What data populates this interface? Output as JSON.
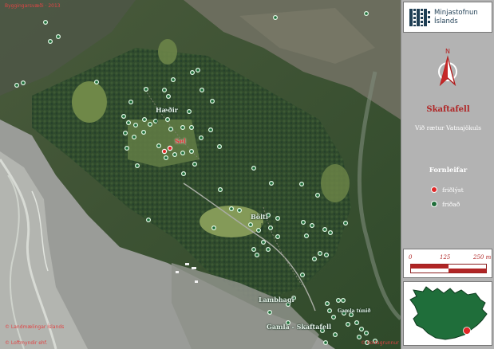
{
  "colors": {
    "site_red": "#e02828",
    "site_green": "#1f6e3a",
    "brand": "#1f3e54",
    "title_red": "#b02525"
  },
  "map": {
    "corner_top_left": "Byggingarsvæði · 2013",
    "corner_bottom_left": "© Landmælingar Íslands",
    "corner_bottom_left_2": "© Loftmyndir ehf.",
    "corner_bottom_right": "© Kortagrunnur",
    "place_labels": [
      "Hæðir",
      "Sel",
      "Bölti",
      "Lambhagi",
      "Gamla - Skaftafell",
      "Gamla túnið"
    ],
    "sites_protected_count": 2,
    "sites_unprotected_icon": "green-ring-dot",
    "sites_protected_icon": "red-ring-dot"
  },
  "sidebar": {
    "logo": {
      "line1": "Minjastofnun",
      "line2": "Íslands",
      "mark_icon": "minjastofnun-m-logo-icon"
    },
    "north_arrow": {
      "label": "N",
      "icon": "north-arrow-icon"
    },
    "place_title": "Skaftafell",
    "place_subtitle": "Við rætur Vatnajökuls",
    "legend": {
      "title": "Fornleifar",
      "items": [
        {
          "label": "friðlýst",
          "color": "#e02828"
        },
        {
          "label": "friðað",
          "color": "#1f6e3a"
        }
      ]
    },
    "scale_bar": {
      "labels": [
        "0",
        "125",
        "250 m"
      ],
      "icon": "scale-bar-icon"
    },
    "inset_map": {
      "icon": "iceland-locator-map-icon"
    }
  }
}
